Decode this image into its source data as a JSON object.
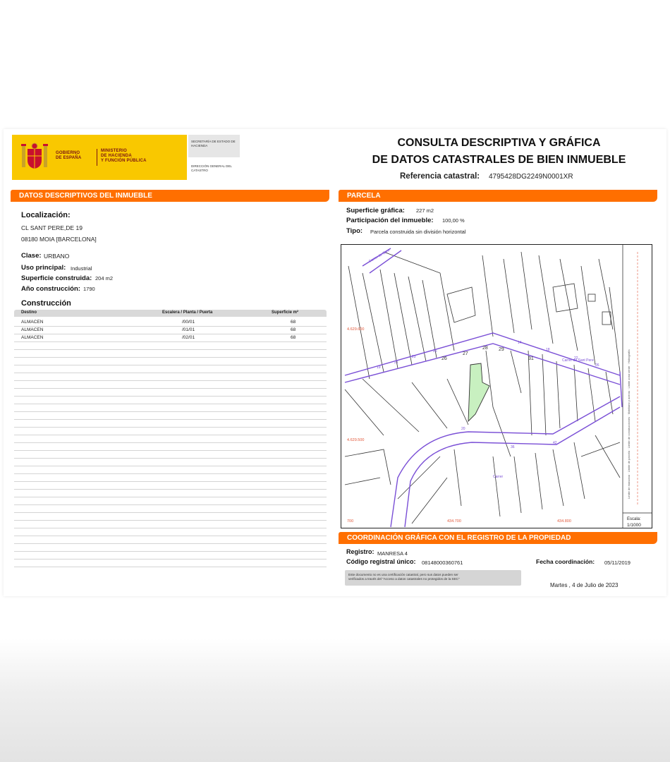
{
  "header": {
    "gov_line1": "GOBIERNO",
    "gov_line2": "DE ESPAÑA",
    "ministry_line1": "MINISTERIO",
    "ministry_line2": "DE HACIENDA",
    "ministry_line3": "Y FUNCIÓN PÚBLICA",
    "secretaria": "SECRETARÍA DE ESTADO DE HACIENDA",
    "direccion": "DIRECCIÓN GENERAL DEL CATASTRO",
    "title_line1": "CONSULTA DESCRIPTIVA Y GRÁFICA",
    "title_line2": "DE DATOS CATASTRALES DE BIEN INMUEBLE",
    "ref_label": "Referencia catastral:",
    "ref_value": "4795428DG2249N0001XR"
  },
  "datos": {
    "section_title": "DATOS DESCRIPTIVOS DEL INMUEBLE",
    "localizacion_label": "Localización:",
    "address_line1": "CL SANT PERE,DE 19",
    "address_line2": "08180 MOIA [BARCELONA]",
    "clase_label": "Clase:",
    "clase_value": "URBANO",
    "uso_label": "Uso principal:",
    "uso_value": "Industrial",
    "superficie_label": "Superficie construida:",
    "superficie_value": "204 m2",
    "anio_label": "Año construcción:",
    "anio_value": "1790"
  },
  "construccion": {
    "title": "Construcción",
    "columns": [
      "Destino",
      "Escalera / Planta / Puerta",
      "Superficie m²"
    ],
    "rows": [
      {
        "destino": "ALMACEN",
        "planta": "/00/01",
        "superficie": "68"
      },
      {
        "destino": "ALMACEN",
        "planta": "/01/01",
        "superficie": "68"
      },
      {
        "destino": "ALMACEN",
        "planta": "/02/01",
        "superficie": "68"
      }
    ]
  },
  "parcela": {
    "section_title": "PARCELA",
    "sup_label": "Superficie gráfica:",
    "sup_value": "227 m2",
    "part_label": "Participación del inmueble:",
    "part_value": "100,00 %",
    "tipo_label": "Tipo:",
    "tipo_value": "Parcela construida sin división horizontal"
  },
  "map": {
    "coord_n1": "4.629.600",
    "coord_n2": "4.629.500",
    "coord_e1": "700",
    "coord_e2": "434.700",
    "coord_e3": "434.800",
    "scale_label": "Escala:",
    "scale_value": "1/1000",
    "plot_numbers": [
      "26",
      "27",
      "28",
      "29",
      "31"
    ],
    "legend_vertical": "Límite de manzana · Límite de parcela · Límite de construcciones · Mobiliario y aceras · Límite zona verde · Hidrografía"
  },
  "coordinacion": {
    "section_title": "COORDINACIÓN GRÁFICA CON EL REGISTRO DE LA PROPIEDAD",
    "registro_label": "Registro:",
    "registro_value": "MANRESA 4",
    "codigo_label": "Código registral único:",
    "codigo_value": "08148000360761",
    "fecha_label": "Fecha coordinación:",
    "fecha_value": "05/11/2019",
    "notice_line1": "Este documento no es una certificación catastral, pero sus datos pueden ser",
    "notice_line2": "verificados a través del \"Acceso a datos catastrales no protegidos de la SEC\"",
    "date": "Martes , 4 de Julio de 2023"
  },
  "colors": {
    "orange": "#ff6f00",
    "gov_yellow": "#f9c800",
    "parcel_green": "#c8f0c0",
    "street_purple": "#7a4fd6"
  }
}
